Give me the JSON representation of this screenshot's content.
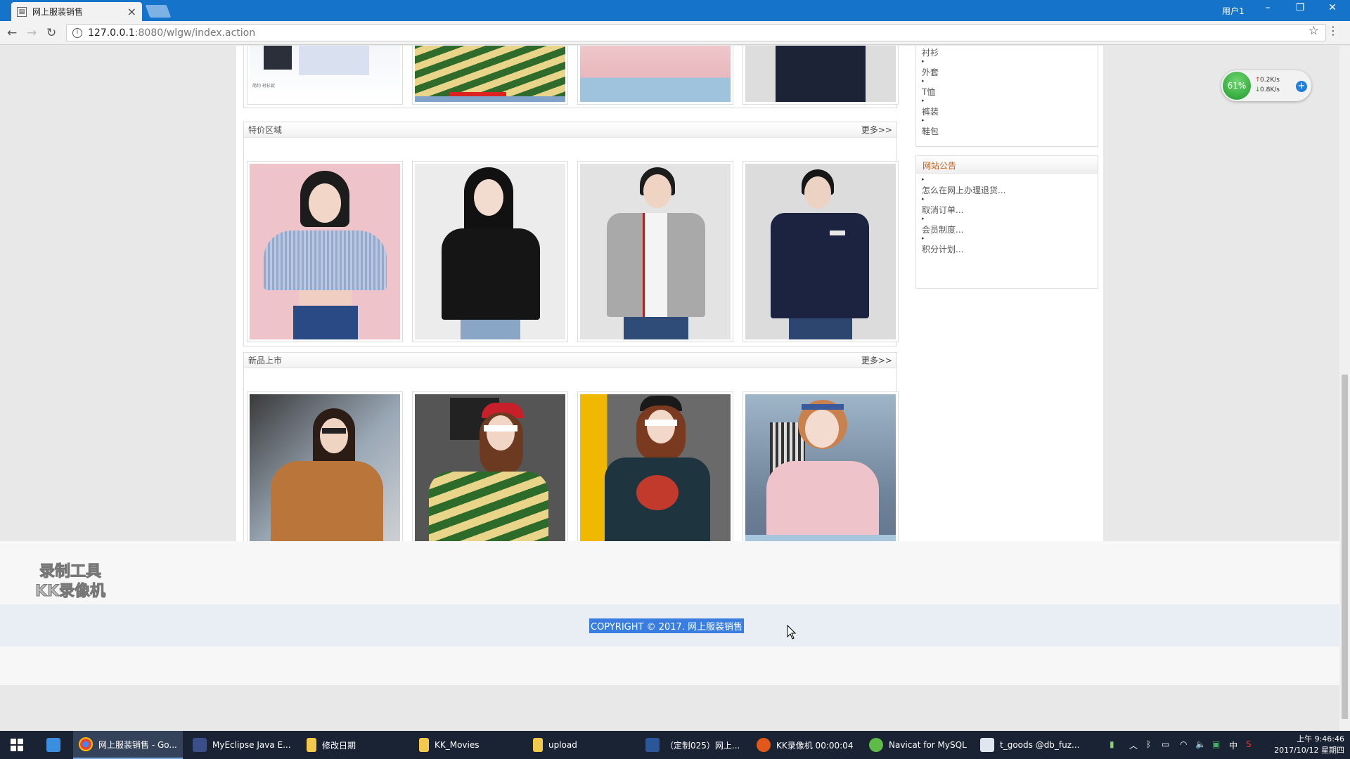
{
  "browser": {
    "tab_title": "网上服装销售",
    "user_label": "用户1",
    "url_host": "127.0.0.1",
    "url_path": ":8080/wlgw/index.action"
  },
  "sections": {
    "sale": {
      "title": "特价区域",
      "more": "更多>>"
    },
    "new": {
      "title": "新品上市",
      "more": "更多>>"
    }
  },
  "top_partial_caption": "简约 衬衫款",
  "sidebar": {
    "categories": [
      {
        "label": "衬衫"
      },
      {
        "label": "外套"
      },
      {
        "label": "T恤"
      },
      {
        "label": "裤装"
      },
      {
        "label": "鞋包"
      }
    ],
    "notice_title": "网站公告",
    "notices": [
      {
        "label": "怎么在网上办理退货..."
      },
      {
        "label": "取消订单..."
      },
      {
        "label": "会员制度..."
      },
      {
        "label": "积分计划..."
      }
    ]
  },
  "footer": {
    "copyright": "COPYRIGHT © 2017. 网上服装销售"
  },
  "watermark": {
    "line1": "录制工具",
    "line2": "KK录像机"
  },
  "net_widget": {
    "percent": "61%",
    "up": "0.2K/s",
    "down": "0.8K/s"
  },
  "taskbar": {
    "items": [
      {
        "label": "网上服装销售 - Go..."
      },
      {
        "label": "MyEclipse Java E..."
      },
      {
        "label": "修改日期"
      },
      {
        "label": "KK_Movies"
      },
      {
        "label": "upload"
      },
      {
        "label": "（定制025）网上..."
      },
      {
        "label": "KK录像机 00:00:04"
      },
      {
        "label": "Navicat for MySQL"
      },
      {
        "label": "t_goods @db_fuz..."
      }
    ],
    "ime": "中",
    "time": "上午 9:46:46",
    "date": "2017/10/12 星期四"
  }
}
